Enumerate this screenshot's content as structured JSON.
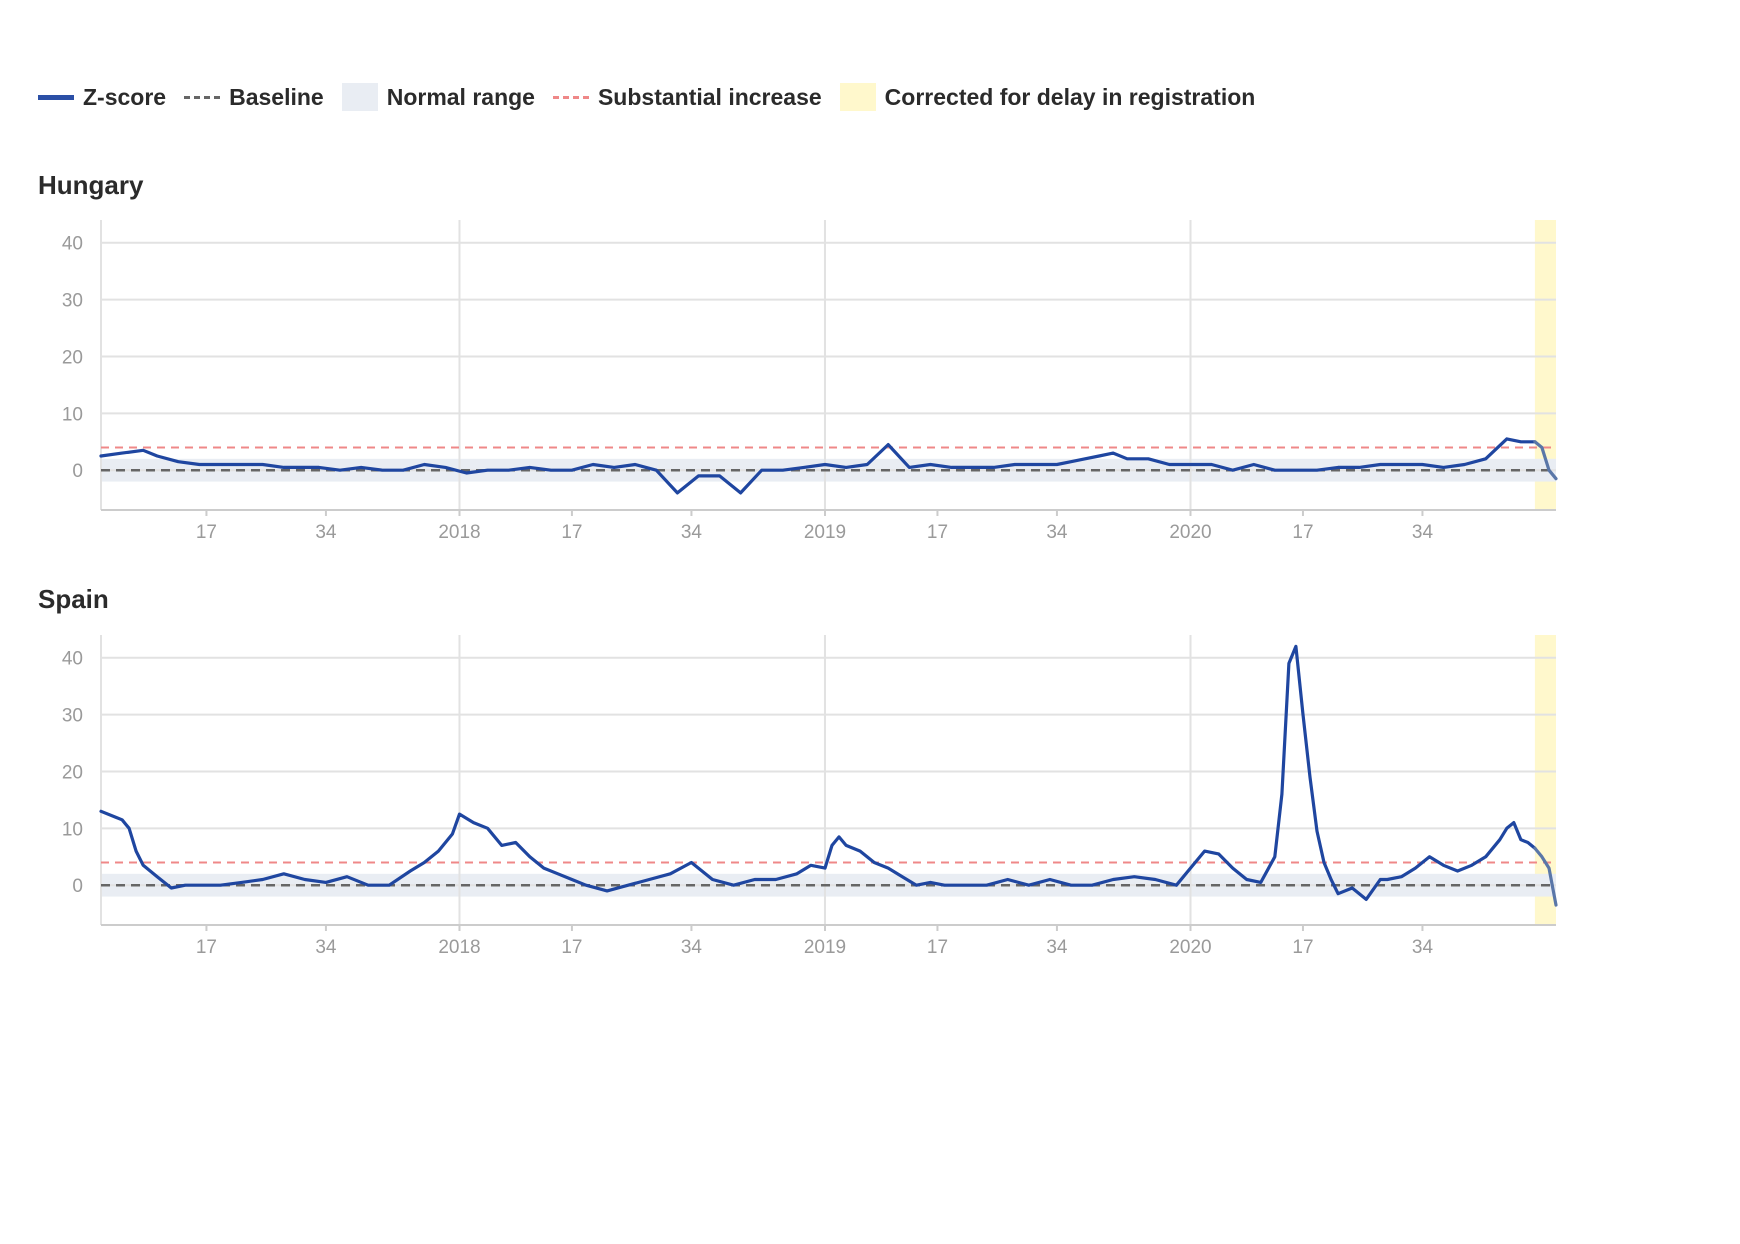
{
  "legend": {
    "zscore": "Z-score",
    "baseline": "Baseline",
    "normal_range": "Normal range",
    "substantial_increase": "Substantial increase",
    "corrected": "Corrected for delay in registration"
  },
  "colors": {
    "zscore": "#1f46a0",
    "zscore_corrected": "#5a77a8",
    "baseline": "#666666",
    "normal_band": "#e9edf3",
    "substantial": "#ef8888",
    "corrected_band": "#fff8cc",
    "grid": "#e2e2e2",
    "tick_text": "#9a9a9a"
  },
  "chart_data": [
    {
      "type": "line",
      "title": "Hungary",
      "x_ticks": [
        "17",
        "34",
        "2018",
        "17",
        "34",
        "2019",
        "17",
        "34",
        "2020",
        "17",
        "34"
      ],
      "x_tick_weeks": [
        17,
        34,
        53,
        69,
        86,
        105,
        121,
        138,
        157,
        173,
        190
      ],
      "y_ticks": [
        0,
        10,
        20,
        30,
        40
      ],
      "ylim": [
        -7,
        44
      ],
      "xlim": [
        2,
        209
      ],
      "baseline": 0,
      "normal_range": [
        -2,
        2
      ],
      "substantial_increase": 4,
      "corrected_from_week": 206,
      "series": [
        {
          "x": [
            2,
            5,
            8,
            10,
            13,
            16,
            20,
            25,
            28,
            30,
            33,
            36,
            39,
            42,
            45,
            48,
            51,
            54,
            57,
            60,
            63,
            66,
            69,
            72,
            75,
            78,
            81,
            84,
            87,
            90,
            93,
            96,
            99,
            102,
            105,
            108,
            111,
            114,
            117,
            120,
            123,
            126,
            129,
            132,
            135,
            138,
            140,
            142,
            144,
            146,
            148,
            151,
            154,
            157,
            160,
            163,
            166,
            169,
            172,
            175,
            178,
            181,
            184,
            187,
            190,
            193,
            196,
            199,
            202,
            204,
            206,
            207,
            208,
            209
          ],
          "y": [
            2.5,
            3,
            3.5,
            2.5,
            1.5,
            1,
            1,
            1,
            0.5,
            0.5,
            0.5,
            0,
            0.5,
            0,
            0,
            1,
            0.5,
            -0.5,
            0,
            0,
            0.5,
            0,
            0,
            1,
            0.5,
            1,
            0,
            -4,
            -1,
            -1,
            -4,
            0,
            0,
            0.5,
            1,
            0.5,
            1,
            4.5,
            0.5,
            1,
            0.5,
            0.5,
            0.5,
            1,
            1,
            1,
            1.5,
            2,
            2.5,
            3,
            2,
            2,
            1,
            1,
            1,
            0,
            1,
            0,
            0,
            0,
            0.5,
            0.5,
            1,
            1,
            1,
            0.5,
            1,
            2,
            5.5,
            5,
            5,
            4,
            0,
            -1.5
          ]
        }
      ]
    },
    {
      "type": "line",
      "title": "Spain",
      "x_ticks": [
        "17",
        "34",
        "2018",
        "17",
        "34",
        "2019",
        "17",
        "34",
        "2020",
        "17",
        "34"
      ],
      "x_tick_weeks": [
        17,
        34,
        53,
        69,
        86,
        105,
        121,
        138,
        157,
        173,
        190
      ],
      "y_ticks": [
        0,
        10,
        20,
        30,
        40
      ],
      "ylim": [
        -7,
        44
      ],
      "xlim": [
        2,
        209
      ],
      "baseline": 0,
      "normal_range": [
        -2,
        2
      ],
      "substantial_increase": 4,
      "corrected_from_week": 206,
      "series": [
        {
          "x": [
            2,
            4,
            5,
            6,
            7,
            8,
            10,
            12,
            14,
            16,
            19,
            22,
            25,
            28,
            31,
            34,
            37,
            40,
            43,
            46,
            48,
            50,
            52,
            53,
            55,
            57,
            59,
            61,
            63,
            65,
            67,
            69,
            71,
            74,
            77,
            80,
            83,
            86,
            89,
            92,
            95,
            98,
            101,
            103,
            105,
            106,
            107,
            108,
            110,
            112,
            114,
            116,
            118,
            120,
            122,
            125,
            128,
            131,
            134,
            137,
            140,
            143,
            146,
            149,
            152,
            155,
            157,
            159,
            161,
            163,
            165,
            167,
            169,
            170,
            171,
            172,
            173,
            174,
            175,
            176,
            177,
            178,
            180,
            182,
            184,
            185,
            187,
            189,
            191,
            193,
            195,
            197,
            199,
            201,
            202,
            203,
            204,
            205,
            206,
            207,
            208,
            209
          ],
          "y": [
            13,
            12,
            11.5,
            10,
            6,
            3.5,
            1.5,
            -0.5,
            0,
            0,
            0,
            0.5,
            1,
            2,
            1,
            0.5,
            1.5,
            0,
            0,
            2.5,
            4,
            6,
            9,
            12.5,
            11,
            10,
            7,
            7.5,
            5,
            3,
            2,
            1,
            0,
            -1,
            0,
            1,
            2,
            4,
            1,
            0,
            1,
            1,
            2,
            3.5,
            3,
            7,
            8.5,
            7,
            6,
            4,
            3,
            1.5,
            0,
            0.5,
            0,
            0,
            0,
            1,
            0,
            1,
            0,
            0,
            1,
            1.5,
            1,
            0,
            3,
            6,
            5.5,
            3,
            1,
            0.5,
            5,
            16,
            39,
            42,
            30,
            19,
            9.5,
            4,
            1,
            -1.5,
            -0.5,
            -2.5,
            1,
            1,
            1.5,
            3,
            5,
            3.5,
            2.5,
            3.5,
            5,
            8,
            10,
            11,
            8,
            7.5,
            6.5,
            5,
            3,
            -3.5
          ]
        }
      ]
    }
  ]
}
